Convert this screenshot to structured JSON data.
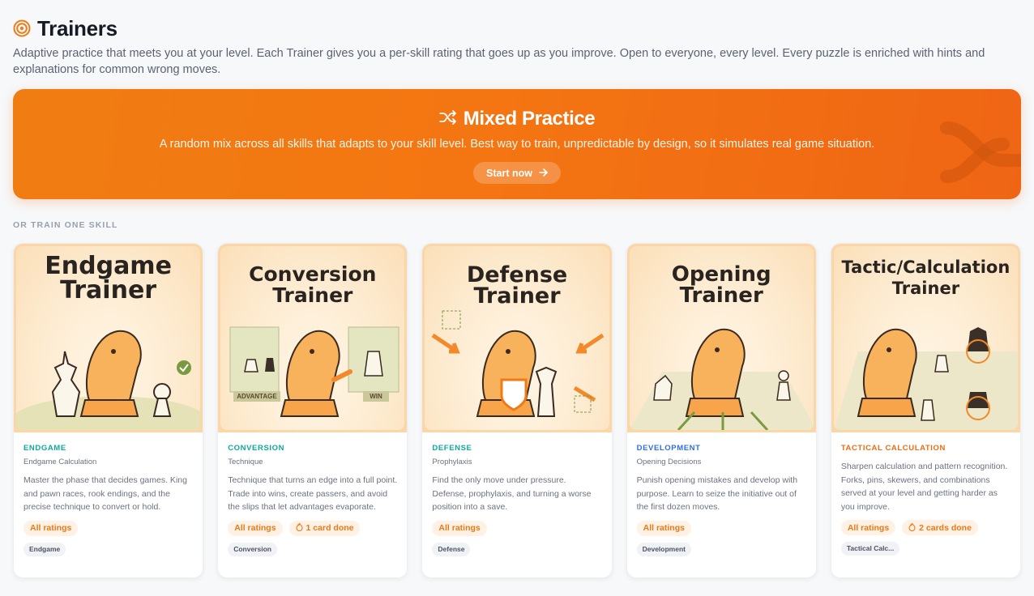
{
  "header": {
    "title": "Trainers",
    "subtitle": "Adaptive practice that meets you at your level. Each Trainer gives you a per-skill rating that goes up as you improve. Open to everyone, every level. Every puzzle is enriched with hints and explanations for common wrong moves.",
    "icon": "target-icon"
  },
  "hero": {
    "title": "Mixed Practice",
    "description": "A random mix across all skills that adapts to your skill level. Best way to train, unpredictable by design, so it simulates real game situation.",
    "button_label": "Start now",
    "icon": "shuffle-icon",
    "accent": "#f47612"
  },
  "section_label": "OR TRAIN ONE SKILL",
  "cards": [
    {
      "image_title_1": "Endgame",
      "image_title_2": "Trainer",
      "category": "ENDGAME",
      "category_color": "#0fa99b",
      "subcategory": "Endgame Calculation",
      "description": "Master the phase that decides games. King and pawn races, rook endings, and the precise technique to convert or hold.",
      "rating_badge": "All ratings",
      "progress_badge": "",
      "tag": "Endgame"
    },
    {
      "image_title_1": "Conversion",
      "image_title_2": "Trainer",
      "image_label_left": "ADVANTAGE",
      "image_label_right": "WIN",
      "category": "CONVERSION",
      "category_color": "#0fa99b",
      "subcategory": "Technique",
      "description": "Technique that turns an edge into a full point. Trade into wins, create passers, and avoid the slips that let advantages evaporate.",
      "rating_badge": "All ratings",
      "progress_badge": "1 card done",
      "tag": "Conversion"
    },
    {
      "image_title_1": "Defense",
      "image_title_2": "Trainer",
      "category": "DEFENSE",
      "category_color": "#0fa99b",
      "subcategory": "Prophylaxis",
      "description": "Find the only move under pressure. Defense, prophylaxis, and turning a worse position into a save.",
      "rating_badge": "All ratings",
      "progress_badge": "",
      "tag": "Defense"
    },
    {
      "image_title_1": "Opening",
      "image_title_2": "Trainer",
      "category": "DEVELOPMENT",
      "category_color": "#2f6fe0",
      "subcategory": "Opening Decisions",
      "description": "Punish opening mistakes and develop with purpose. Learn to seize the initiative out of the first dozen moves.",
      "rating_badge": "All ratings",
      "progress_badge": "",
      "tag": "Development"
    },
    {
      "image_title_1": "Tactic/Calculation",
      "image_title_2": "Trainer",
      "category": "TACTICAL CALCULATION",
      "category_color": "#ea6d12",
      "subcategory": "",
      "description": "Sharpen calculation and pattern recognition. Forks, pins, skewers, and combinations served at your level and getting harder as you improve.",
      "rating_badge": "All ratings",
      "progress_badge": "2 cards done",
      "tag": "Tactical Calc..."
    }
  ]
}
